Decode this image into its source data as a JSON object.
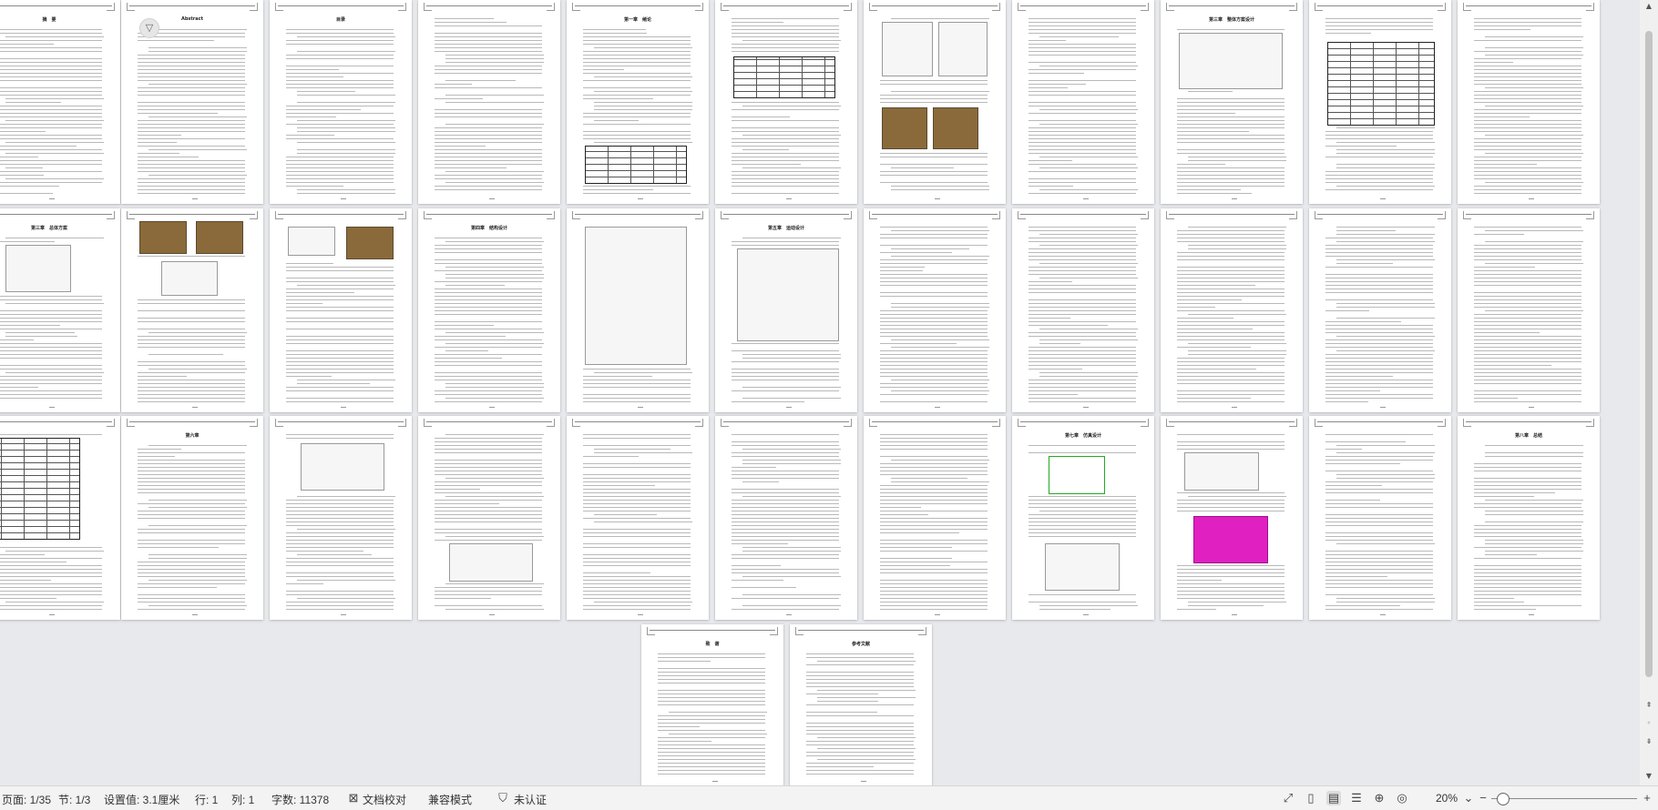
{
  "status": {
    "page": "页面: 1/35",
    "section": "节: 1/3",
    "setting": "设置值: 3.1厘米",
    "row": "行: 1",
    "col": "列: 1",
    "wordcount": "字数: 11378",
    "proofread": "文档校对",
    "compat": "兼容模式",
    "cert": "未认证",
    "zoom": "20%",
    "zoom_level": 0.2
  },
  "pages": {
    "r0": [
      "摘　要",
      "Abstract",
      "目录",
      "",
      "第一章　绪论",
      "",
      "",
      "",
      "第三章　整体方案设计",
      "",
      ""
    ],
    "r1": [
      "第三章　总体方案",
      "",
      "",
      "第四章　结构设计",
      "",
      "第五章　运动设计",
      "",
      "",
      "",
      "",
      ""
    ],
    "r2": [
      "",
      "第六章",
      "",
      "",
      "",
      "",
      "",
      "第七章　仿真设计",
      "",
      "",
      "第八章　总结"
    ],
    "r3": [
      "致　谢",
      "参考文献"
    ]
  },
  "icons": {
    "fold": "filter-icon",
    "proofread": "doc-check-icon",
    "cert": "shield-icon"
  }
}
